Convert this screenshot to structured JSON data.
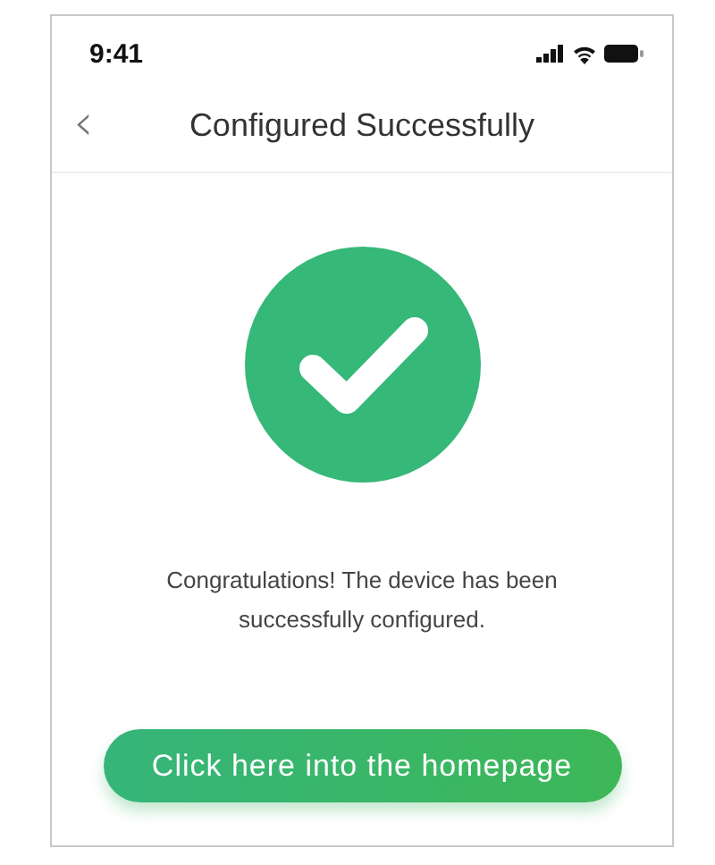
{
  "status_bar": {
    "time": "9:41"
  },
  "nav_bar": {
    "back": "‹",
    "title": "Configured Successfully"
  },
  "message": "Congratulations! The device has been successfully configured.",
  "button": {
    "label": "Click here into the homepage"
  }
}
